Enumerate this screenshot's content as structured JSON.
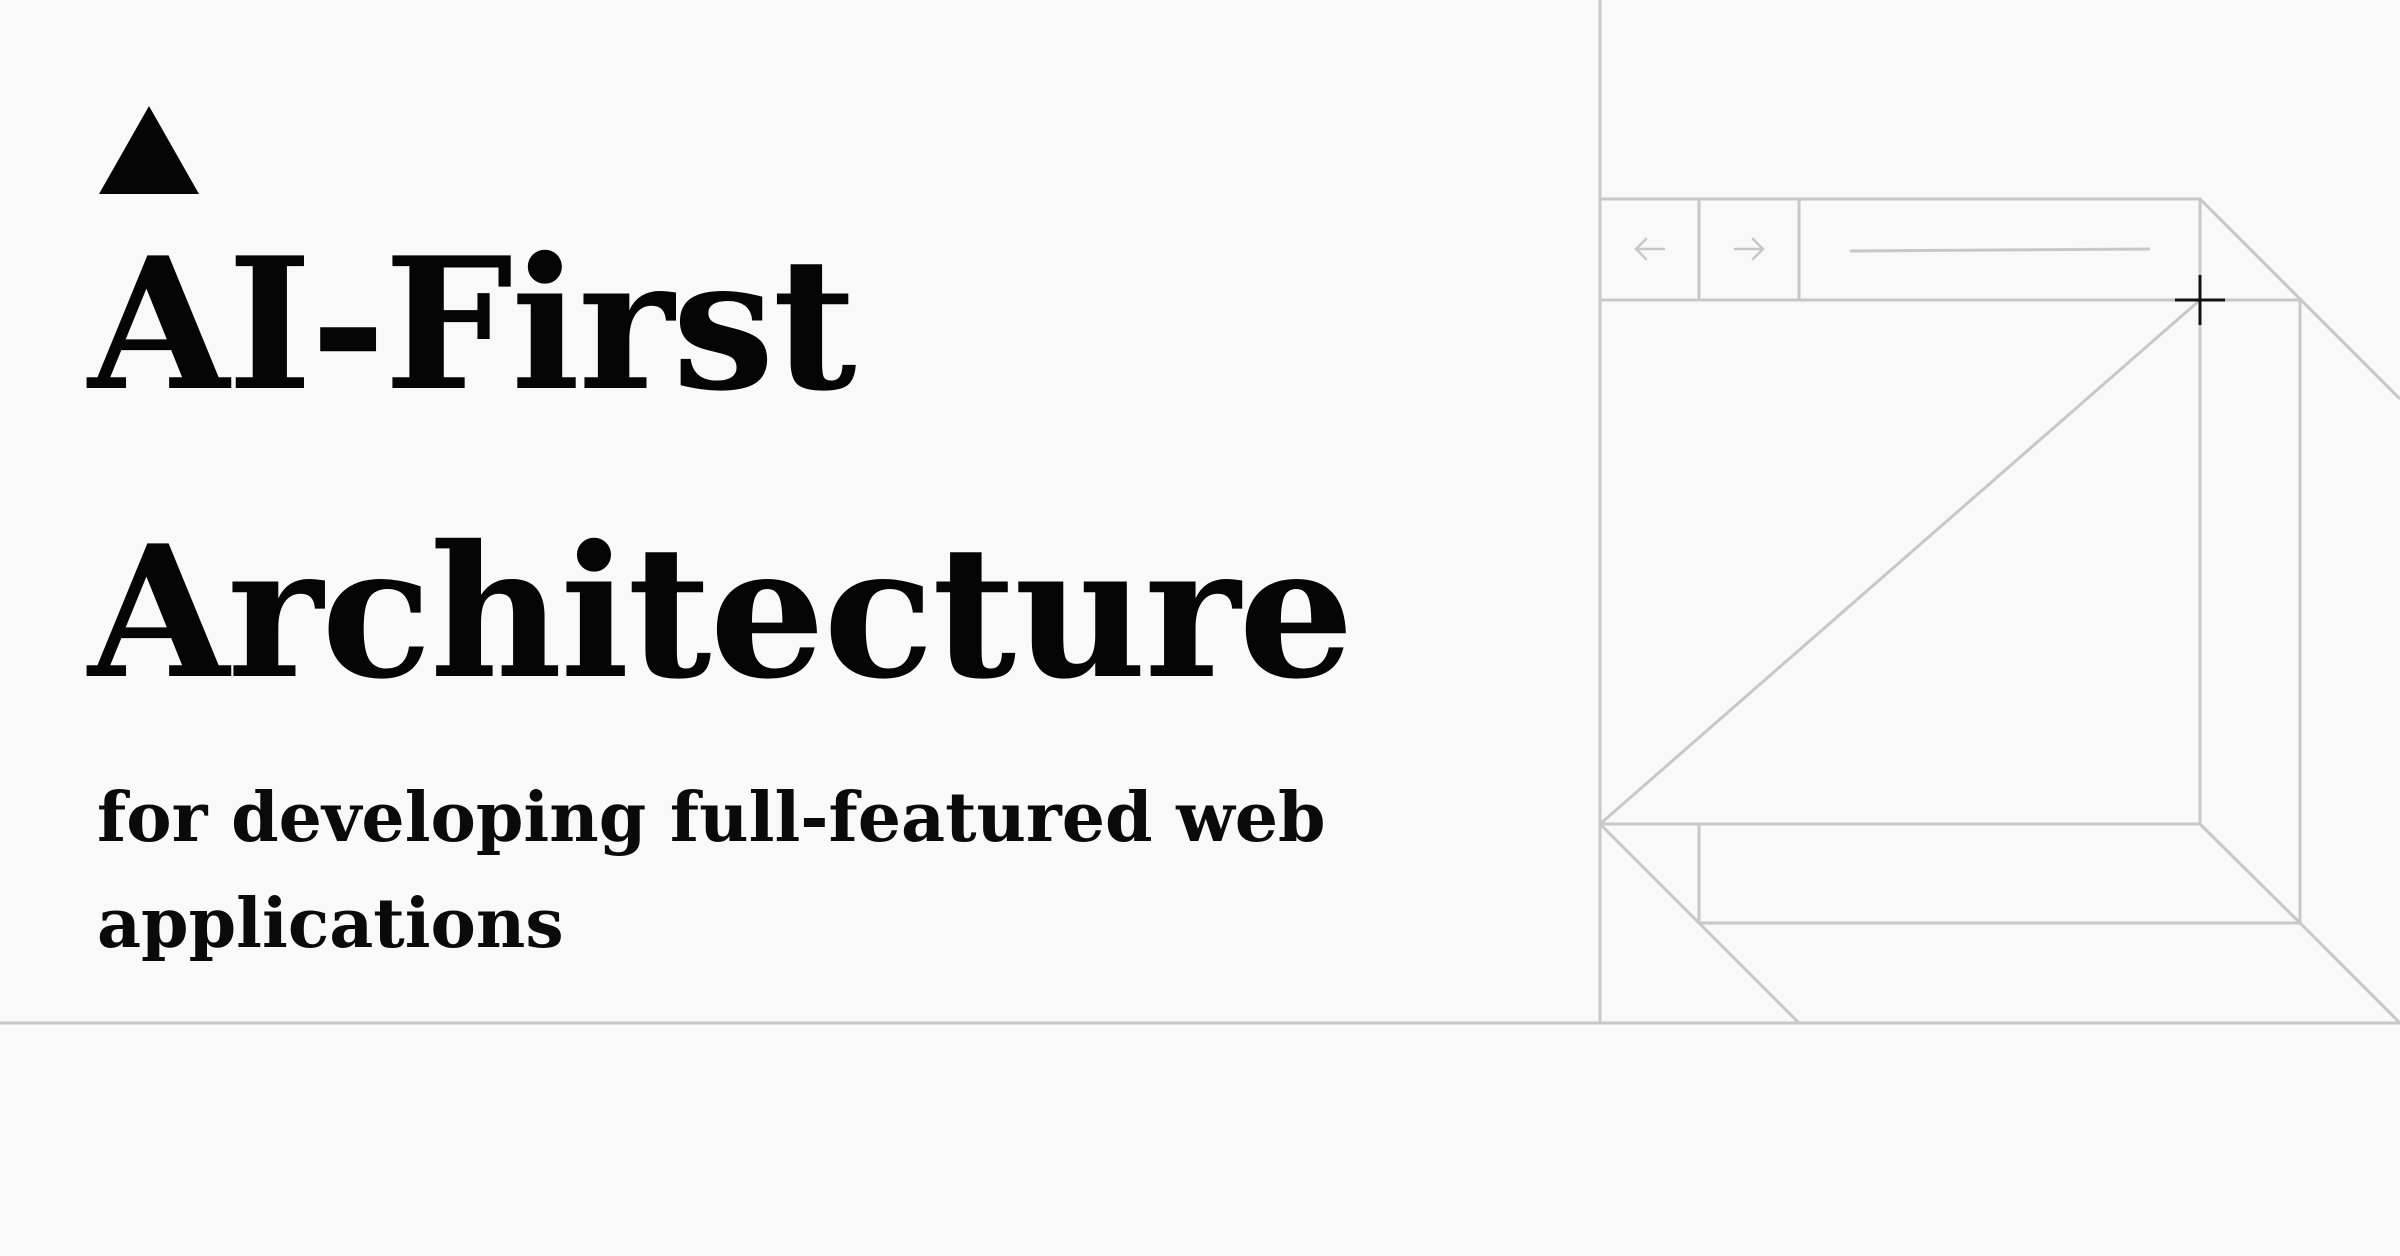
{
  "hero": {
    "logo_icon": "triangle-logo-icon",
    "title_line1": "AI-First",
    "title_line2": "Architecture",
    "subtitle_line1": "for developing full-featured web",
    "subtitle_line2": "applications"
  },
  "browser_illustration": {
    "back_icon": "arrow-left-icon",
    "forward_icon": "arrow-right-icon",
    "cursor_icon": "crosshair-cursor-icon"
  },
  "colors": {
    "background": "#f9f9f9",
    "text": "#050505",
    "line": "#c8c8c8"
  }
}
